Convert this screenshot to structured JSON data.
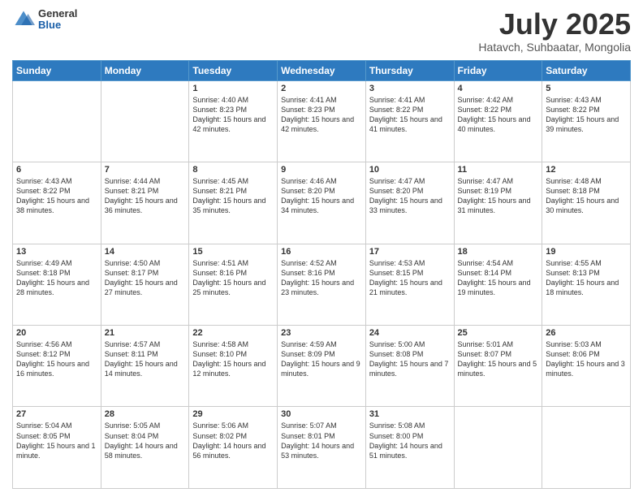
{
  "header": {
    "logo": {
      "general": "General",
      "blue": "Blue"
    },
    "title": "July 2025",
    "subtitle": "Hatavch, Suhbaatar, Mongolia"
  },
  "calendar": {
    "days_of_week": [
      "Sunday",
      "Monday",
      "Tuesday",
      "Wednesday",
      "Thursday",
      "Friday",
      "Saturday"
    ],
    "weeks": [
      [
        {
          "day": "",
          "content": ""
        },
        {
          "day": "",
          "content": ""
        },
        {
          "day": "1",
          "content": "Sunrise: 4:40 AM\nSunset: 8:23 PM\nDaylight: 15 hours and 42 minutes."
        },
        {
          "day": "2",
          "content": "Sunrise: 4:41 AM\nSunset: 8:23 PM\nDaylight: 15 hours and 42 minutes."
        },
        {
          "day": "3",
          "content": "Sunrise: 4:41 AM\nSunset: 8:22 PM\nDaylight: 15 hours and 41 minutes."
        },
        {
          "day": "4",
          "content": "Sunrise: 4:42 AM\nSunset: 8:22 PM\nDaylight: 15 hours and 40 minutes."
        },
        {
          "day": "5",
          "content": "Sunrise: 4:43 AM\nSunset: 8:22 PM\nDaylight: 15 hours and 39 minutes."
        }
      ],
      [
        {
          "day": "6",
          "content": "Sunrise: 4:43 AM\nSunset: 8:22 PM\nDaylight: 15 hours and 38 minutes."
        },
        {
          "day": "7",
          "content": "Sunrise: 4:44 AM\nSunset: 8:21 PM\nDaylight: 15 hours and 36 minutes."
        },
        {
          "day": "8",
          "content": "Sunrise: 4:45 AM\nSunset: 8:21 PM\nDaylight: 15 hours and 35 minutes."
        },
        {
          "day": "9",
          "content": "Sunrise: 4:46 AM\nSunset: 8:20 PM\nDaylight: 15 hours and 34 minutes."
        },
        {
          "day": "10",
          "content": "Sunrise: 4:47 AM\nSunset: 8:20 PM\nDaylight: 15 hours and 33 minutes."
        },
        {
          "day": "11",
          "content": "Sunrise: 4:47 AM\nSunset: 8:19 PM\nDaylight: 15 hours and 31 minutes."
        },
        {
          "day": "12",
          "content": "Sunrise: 4:48 AM\nSunset: 8:18 PM\nDaylight: 15 hours and 30 minutes."
        }
      ],
      [
        {
          "day": "13",
          "content": "Sunrise: 4:49 AM\nSunset: 8:18 PM\nDaylight: 15 hours and 28 minutes."
        },
        {
          "day": "14",
          "content": "Sunrise: 4:50 AM\nSunset: 8:17 PM\nDaylight: 15 hours and 27 minutes."
        },
        {
          "day": "15",
          "content": "Sunrise: 4:51 AM\nSunset: 8:16 PM\nDaylight: 15 hours and 25 minutes."
        },
        {
          "day": "16",
          "content": "Sunrise: 4:52 AM\nSunset: 8:16 PM\nDaylight: 15 hours and 23 minutes."
        },
        {
          "day": "17",
          "content": "Sunrise: 4:53 AM\nSunset: 8:15 PM\nDaylight: 15 hours and 21 minutes."
        },
        {
          "day": "18",
          "content": "Sunrise: 4:54 AM\nSunset: 8:14 PM\nDaylight: 15 hours and 19 minutes."
        },
        {
          "day": "19",
          "content": "Sunrise: 4:55 AM\nSunset: 8:13 PM\nDaylight: 15 hours and 18 minutes."
        }
      ],
      [
        {
          "day": "20",
          "content": "Sunrise: 4:56 AM\nSunset: 8:12 PM\nDaylight: 15 hours and 16 minutes."
        },
        {
          "day": "21",
          "content": "Sunrise: 4:57 AM\nSunset: 8:11 PM\nDaylight: 15 hours and 14 minutes."
        },
        {
          "day": "22",
          "content": "Sunrise: 4:58 AM\nSunset: 8:10 PM\nDaylight: 15 hours and 12 minutes."
        },
        {
          "day": "23",
          "content": "Sunrise: 4:59 AM\nSunset: 8:09 PM\nDaylight: 15 hours and 9 minutes."
        },
        {
          "day": "24",
          "content": "Sunrise: 5:00 AM\nSunset: 8:08 PM\nDaylight: 15 hours and 7 minutes."
        },
        {
          "day": "25",
          "content": "Sunrise: 5:01 AM\nSunset: 8:07 PM\nDaylight: 15 hours and 5 minutes."
        },
        {
          "day": "26",
          "content": "Sunrise: 5:03 AM\nSunset: 8:06 PM\nDaylight: 15 hours and 3 minutes."
        }
      ],
      [
        {
          "day": "27",
          "content": "Sunrise: 5:04 AM\nSunset: 8:05 PM\nDaylight: 15 hours and 1 minute."
        },
        {
          "day": "28",
          "content": "Sunrise: 5:05 AM\nSunset: 8:04 PM\nDaylight: 14 hours and 58 minutes."
        },
        {
          "day": "29",
          "content": "Sunrise: 5:06 AM\nSunset: 8:02 PM\nDaylight: 14 hours and 56 minutes."
        },
        {
          "day": "30",
          "content": "Sunrise: 5:07 AM\nSunset: 8:01 PM\nDaylight: 14 hours and 53 minutes."
        },
        {
          "day": "31",
          "content": "Sunrise: 5:08 AM\nSunset: 8:00 PM\nDaylight: 14 hours and 51 minutes."
        },
        {
          "day": "",
          "content": ""
        },
        {
          "day": "",
          "content": ""
        }
      ]
    ]
  }
}
